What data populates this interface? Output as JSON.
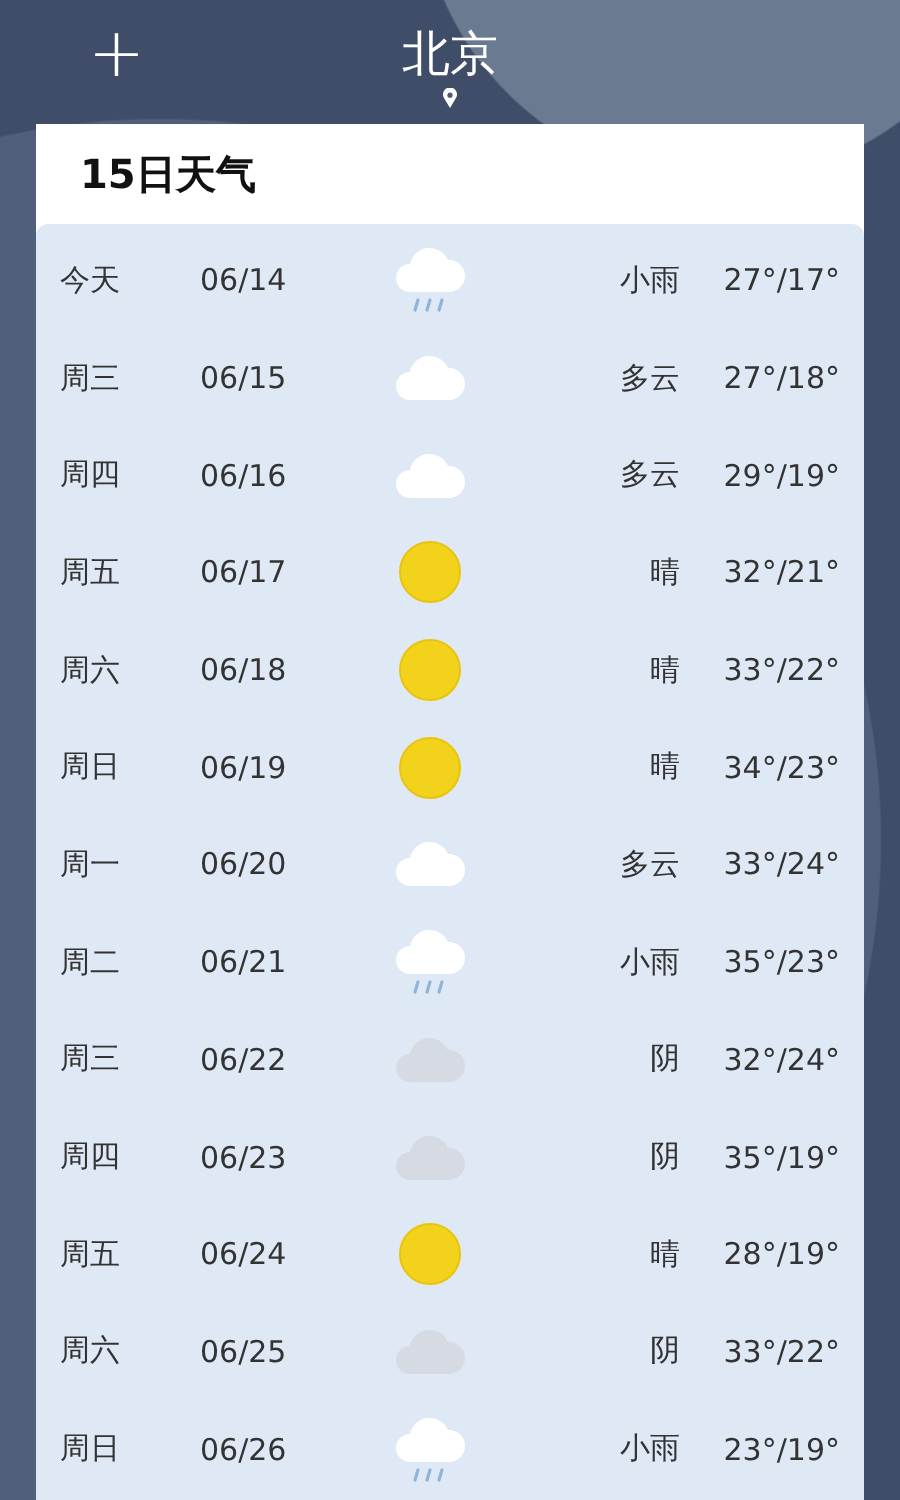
{
  "header": {
    "add_button": "+",
    "city": "北京"
  },
  "card": {
    "title": "15日天气",
    "days": [
      {
        "day": "今天",
        "date": "06/14",
        "kind": "rain",
        "condition": "小雨",
        "temps": "27°/17°"
      },
      {
        "day": "周三",
        "date": "06/15",
        "kind": "cloudy",
        "condition": "多云",
        "temps": "27°/18°"
      },
      {
        "day": "周四",
        "date": "06/16",
        "kind": "cloudy",
        "condition": "多云",
        "temps": "29°/19°"
      },
      {
        "day": "周五",
        "date": "06/17",
        "kind": "sunny",
        "condition": "晴",
        "temps": "32°/21°"
      },
      {
        "day": "周六",
        "date": "06/18",
        "kind": "sunny",
        "condition": "晴",
        "temps": "33°/22°"
      },
      {
        "day": "周日",
        "date": "06/19",
        "kind": "sunny",
        "condition": "晴",
        "temps": "34°/23°"
      },
      {
        "day": "周一",
        "date": "06/20",
        "kind": "cloudy",
        "condition": "多云",
        "temps": "33°/24°"
      },
      {
        "day": "周二",
        "date": "06/21",
        "kind": "rain",
        "condition": "小雨",
        "temps": "35°/23°"
      },
      {
        "day": "周三",
        "date": "06/22",
        "kind": "overcast",
        "condition": "阴",
        "temps": "32°/24°"
      },
      {
        "day": "周四",
        "date": "06/23",
        "kind": "overcast",
        "condition": "阴",
        "temps": "35°/19°"
      },
      {
        "day": "周五",
        "date": "06/24",
        "kind": "sunny",
        "condition": "晴",
        "temps": "28°/19°"
      },
      {
        "day": "周六",
        "date": "06/25",
        "kind": "overcast",
        "condition": "阴",
        "temps": "33°/22°"
      },
      {
        "day": "周日",
        "date": "06/26",
        "kind": "rain",
        "condition": "小雨",
        "temps": "23°/19°"
      }
    ]
  }
}
